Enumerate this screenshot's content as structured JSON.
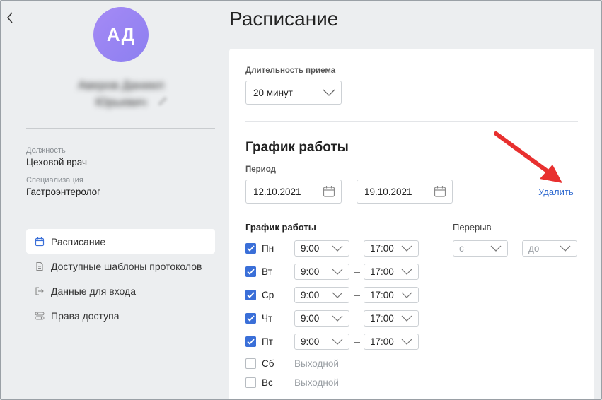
{
  "sidebar": {
    "avatar_initials": "АД",
    "user_name_line1": "Аверов Даниил",
    "user_name_line2": "Юрьевич",
    "position_label": "Должность",
    "position_value": "Цеховой врач",
    "specialization_label": "Специализация",
    "specialization_value": "Гастроэнтеролог",
    "nav": [
      {
        "label": "Расписание",
        "icon": "calendar-icon",
        "active": true
      },
      {
        "label": "Доступные шаблоны протоколов",
        "icon": "document-icon",
        "active": false
      },
      {
        "label": "Данные для входа",
        "icon": "login-icon",
        "active": false
      },
      {
        "label": "Права доступа",
        "icon": "toggles-icon",
        "active": false
      }
    ]
  },
  "main": {
    "title": "Расписание",
    "duration_label": "Длительность приема",
    "duration_value": "20 минут",
    "schedule_title": "График работы",
    "period_label": "Период",
    "period_from": "12.10.2021",
    "period_to": "19.10.2021",
    "delete_label": "Удалить",
    "work_schedule_label": "График работы",
    "break_label": "Перерыв",
    "break_from_placeholder": "с",
    "break_to_placeholder": "до",
    "days": [
      {
        "name": "Пн",
        "checked": true,
        "from": "9:00",
        "to": "17:00"
      },
      {
        "name": "Вт",
        "checked": true,
        "from": "9:00",
        "to": "17:00"
      },
      {
        "name": "Ср",
        "checked": true,
        "from": "9:00",
        "to": "17:00"
      },
      {
        "name": "Чт",
        "checked": true,
        "from": "9:00",
        "to": "17:00"
      },
      {
        "name": "Пт",
        "checked": true,
        "from": "9:00",
        "to": "17:00"
      },
      {
        "name": "Сб",
        "checked": false,
        "off_label": "Выходной"
      },
      {
        "name": "Вс",
        "checked": false,
        "off_label": "Выходной"
      }
    ]
  },
  "colors": {
    "accent": "#3a6fd8",
    "link": "#2f6ad0",
    "annotation_arrow": "#e8302f",
    "avatar": "#9b86f3"
  }
}
